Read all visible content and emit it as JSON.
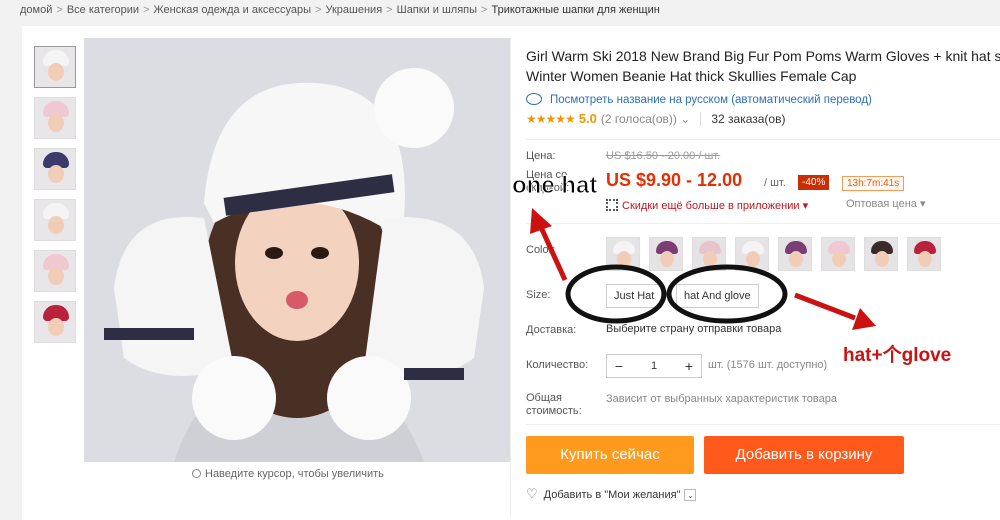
{
  "breadcrumb": [
    "домой",
    "Все категории",
    "Женская одежда и аксессуары",
    "Украшения",
    "Шапки и шляпы",
    "Трикотажные шапки для женщин"
  ],
  "breadcrumb_sep": ">",
  "product": {
    "title_line1": "Girl Warm Ski 2018 New Brand Big Fur Pom Poms Warm Gloves + knit hat s",
    "title_line2": "Winter Women Beanie Hat thick Skullies Female Cap",
    "translate_link": "Посмотреть название на русском (автоматический перевод)",
    "stars": "★★★★★",
    "rating": "5.0",
    "votes": "(2 голоса(ов))",
    "votes_caret": "⌄",
    "orders": "32 заказа(ов)"
  },
  "price": {
    "label": "Цена:",
    "old": "US $16.50 - 20.00 / шт.",
    "sale_label_1": "Цена со",
    "sale_label_2": "скидкой:",
    "current": "US $9.90 - 12.00",
    "unit": "/ шт.",
    "discount": "-40%",
    "timer": "13h:7m:41s",
    "app_deal": "Скидки ещё больше в приложении",
    "app_caret": "▾",
    "wholesale": "Оптовая цена",
    "wholesale_caret": "▾"
  },
  "options": {
    "color_label": "Color:",
    "color_count": 8,
    "hat_colors": [
      "#f4f4f4",
      "#7a3e74",
      "#e7c3cb",
      "#f4f4f4",
      "#7a3e74",
      "#f0c8d2",
      "#3b2a2a",
      "#b8223a"
    ],
    "size_label": "Size:",
    "sizes": [
      "Just Hat",
      "hat And glove"
    ],
    "shipping_label": "Доставка:",
    "shipping_text": "Выберите страну отправки товара",
    "qty_label": "Количество:",
    "qty_minus": "−",
    "qty_value": "1",
    "qty_plus": "+",
    "qty_info": "шт. (1576 шт. доступно)",
    "total_label_1": "Общая",
    "total_label_2": "стоимость:",
    "total_text": "Зависит от выбранных характеристик товара"
  },
  "actions": {
    "buy_now": "Купить сейчас",
    "add_cart": "Добавить в корзину",
    "wishlist": "Добавить в \"Мои желания\"",
    "wish_caret": "⌄"
  },
  "gallery": {
    "zoom_hint": "Наведите курсор, чтобы увеличить",
    "thumb_hat_colors": [
      "#f4f4f4",
      "#f0c8d2",
      "#3b3a6a",
      "#f4f4f4",
      "#f0c8d2",
      "#b8223a"
    ]
  },
  "annotations": {
    "one_hat": "one hat",
    "hat_glove": "hat+个glove",
    "color": "#cc1111"
  },
  "colors": {
    "price_red": "#e62e04",
    "buy_orange": "#ff9a1f",
    "cart_orange": "#ff5a1b",
    "link_blue": "#2d6fb8",
    "star": "#f29500"
  }
}
